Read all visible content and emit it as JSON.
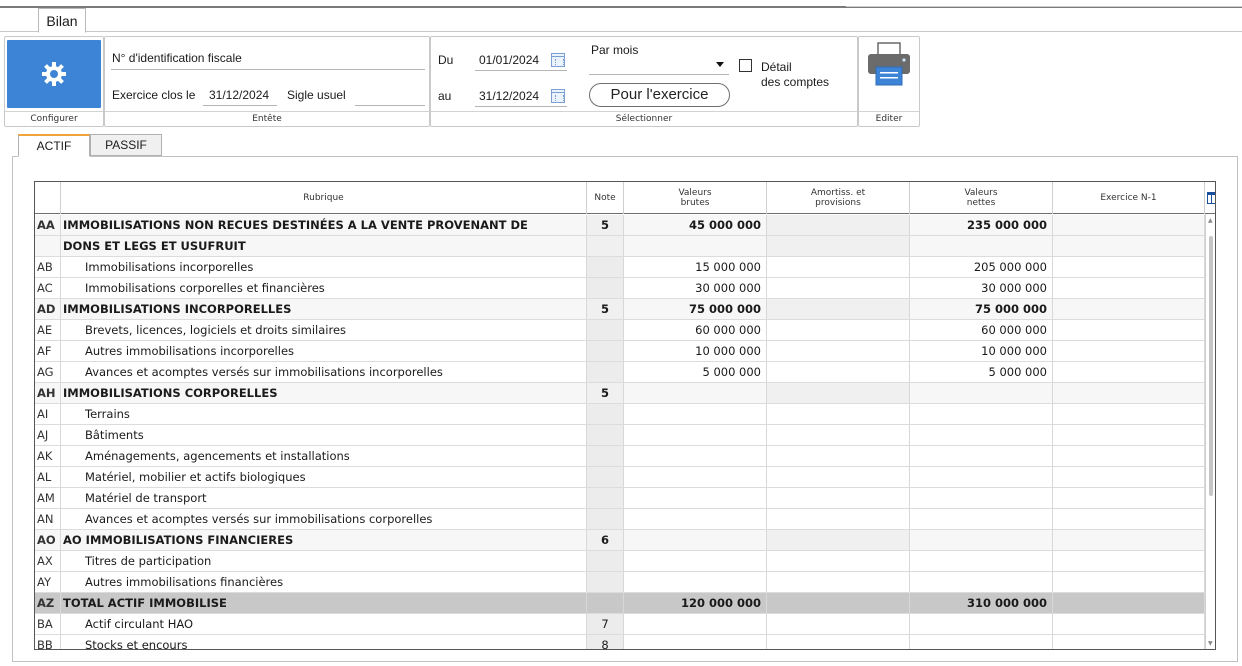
{
  "window": {
    "tab": "Bilan"
  },
  "ribbon": {
    "configurer": {
      "label": "Configurer",
      "icon": "gear-icon",
      "color": "#3d83d6"
    },
    "entete": {
      "label": "Entête",
      "nif_label": "N° d'identification fiscale",
      "nif_value": "",
      "exercice_label": "Exercice clos le",
      "exercice_value": "31/12/2024",
      "sigle_label": "Sigle usuel",
      "sigle_value": ""
    },
    "selectionner": {
      "label": "Sélectionner",
      "du_label": "Du",
      "du_value": "01/01/2024",
      "au_label": "au",
      "au_value": "31/12/2024",
      "period_select": "Par mois",
      "detail_label_1": "Détail",
      "detail_label_2": "des comptes",
      "pour_exercice": "Pour l'exercice"
    },
    "editer": {
      "label": "Editer",
      "icon": "printer-icon"
    }
  },
  "content_tabs": [
    "ACTIF",
    "PASSIF"
  ],
  "grid": {
    "headers": {
      "rubrique": "Rubrique",
      "note": "Note",
      "valeurs_brutes_1": "Valeurs",
      "valeurs_brutes_2": "brutes",
      "amortiss_1": "Amortiss. et",
      "amortiss_2": "provisions",
      "valeurs_nettes_1": "Valeurs",
      "valeurs_nettes_2": "nettes",
      "exercice_n1": "Exercice N-1"
    },
    "rows": [
      {
        "code": "AA",
        "rubrique": "IMMOBILISATIONS NON RECUES DESTINÉES A LA VENTE PROVENANT DE",
        "note": "5",
        "vb": "45 000 000",
        "am": "",
        "vn": "235 000 000",
        "n1": "",
        "style": "section"
      },
      {
        "code": "",
        "rubrique": "DONS ET LEGS ET USUFRUIT",
        "note": "",
        "vb": "",
        "am": "",
        "vn": "",
        "n1": "",
        "style": "section"
      },
      {
        "code": "AB",
        "rubrique": "Immobilisations incorporelles",
        "note": "",
        "vb": "15 000 000",
        "am": "",
        "vn": "205 000 000",
        "n1": "",
        "style": ""
      },
      {
        "code": "AC",
        "rubrique": "Immobilisations corporelles et financières",
        "note": "",
        "vb": "30 000 000",
        "am": "",
        "vn": "30 000 000",
        "n1": "",
        "style": ""
      },
      {
        "code": "AD",
        "rubrique": "IMMOBILISATIONS INCORPORELLES",
        "note": "5",
        "vb": "75 000 000",
        "am": "",
        "vn": "75 000 000",
        "n1": "",
        "style": "section"
      },
      {
        "code": "AE",
        "rubrique": "Brevets, licences, logiciels et droits similaires",
        "note": "",
        "vb": "60 000 000",
        "am": "",
        "vn": "60 000 000",
        "n1": "",
        "style": ""
      },
      {
        "code": "AF",
        "rubrique": "Autres immobilisations incorporelles",
        "note": "",
        "vb": "10 000 000",
        "am": "",
        "vn": "10 000 000",
        "n1": "",
        "style": ""
      },
      {
        "code": "AG",
        "rubrique": "Avances et acomptes versés sur immobilisations incorporelles",
        "note": "",
        "vb": "5 000 000",
        "am": "",
        "vn": "5 000 000",
        "n1": "",
        "style": ""
      },
      {
        "code": "AH",
        "rubrique": "IMMOBILISATIONS CORPORELLES",
        "note": "5",
        "vb": "",
        "am": "",
        "vn": "",
        "n1": "",
        "style": "section"
      },
      {
        "code": "AI",
        "rubrique": "Terrains",
        "note": "",
        "vb": "",
        "am": "",
        "vn": "",
        "n1": "",
        "style": ""
      },
      {
        "code": "AJ",
        "rubrique": "Bâtiments",
        "note": "",
        "vb": "",
        "am": "",
        "vn": "",
        "n1": "",
        "style": ""
      },
      {
        "code": "AK",
        "rubrique": "Aménagements, agencements et installations",
        "note": "",
        "vb": "",
        "am": "",
        "vn": "",
        "n1": "",
        "style": ""
      },
      {
        "code": "AL",
        "rubrique": "Matériel, mobilier et actifs biologiques",
        "note": "",
        "vb": "",
        "am": "",
        "vn": "",
        "n1": "",
        "style": ""
      },
      {
        "code": "AM",
        "rubrique": "Matériel de transport",
        "note": "",
        "vb": "",
        "am": "",
        "vn": "",
        "n1": "",
        "style": ""
      },
      {
        "code": "AN",
        "rubrique": "Avances et acomptes versés sur immobilisations corporelles",
        "note": "",
        "vb": "",
        "am": "",
        "vn": "",
        "n1": "",
        "style": ""
      },
      {
        "code": "AO",
        "rubrique": "AO IMMOBILISATIONS FINANCIERES",
        "note": "6",
        "vb": "",
        "am": "",
        "vn": "",
        "n1": "",
        "style": "section"
      },
      {
        "code": "AX",
        "rubrique": "Titres de participation",
        "note": "",
        "vb": "",
        "am": "",
        "vn": "",
        "n1": "",
        "style": ""
      },
      {
        "code": "AY",
        "rubrique": "Autres immobilisations financières",
        "note": "",
        "vb": "",
        "am": "",
        "vn": "",
        "n1": "",
        "style": ""
      },
      {
        "code": "AZ",
        "rubrique": "TOTAL ACTIF IMMOBILISE",
        "note": "",
        "vb": "120 000 000",
        "am": "",
        "vn": "310 000 000",
        "n1": "",
        "style": "total"
      },
      {
        "code": "BA",
        "rubrique": "Actif circulant HAO",
        "note": "7",
        "vb": "",
        "am": "",
        "vn": "",
        "n1": "",
        "style": ""
      },
      {
        "code": "BB",
        "rubrique": "Stocks et encours",
        "note": "8",
        "vb": "",
        "am": "",
        "vn": "",
        "n1": "",
        "style": ""
      }
    ]
  }
}
